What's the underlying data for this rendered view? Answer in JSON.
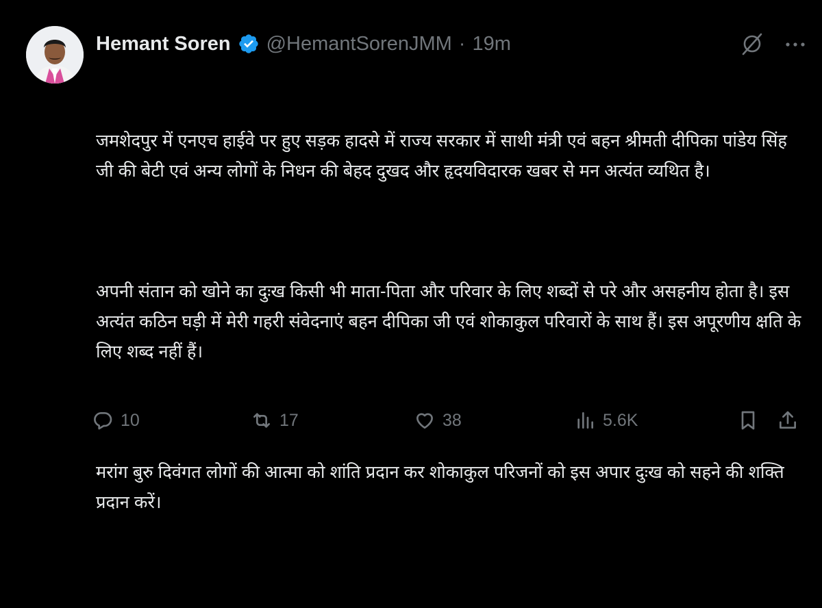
{
  "tweet": {
    "author_name": "Hemant Soren",
    "handle": "@HemantSorenJMM",
    "separator": "·",
    "time": "19m",
    "paragraphs": [
      "जमशेदपुर में एनएच हाईवे पर हुए सड़क हादसे में राज्य सरकार में साथी मंत्री एवं बहन श्रीमती दीपिका पांडेय सिंह जी की बेटी एवं अन्य लोगों के निधन की बेहद दुखद और हृदयविदारक खबर से मन अत्यंत व्यथित है।",
      "अपनी संतान को खोने का दुःख किसी भी माता-पिता और परिवार के लिए शब्दों से परे और असहनीय होता है। इस अत्यंत कठिन घड़ी में मेरी गहरी संवेदनाएं बहन दीपिका जी एवं शोकाकुल परिवारों के साथ हैं। इस अपूरणीय क्षति के लिए शब्द नहीं हैं।",
      "मरांग बुरु दिवंगत लोगों की आत्मा को शांति प्रदान कर शोकाकुल परिजनों को इस अपार दुःख को सहने की शक्ति प्रदान करें।"
    ],
    "stats": {
      "replies": "10",
      "reposts": "17",
      "likes": "38",
      "views": "5.6K"
    }
  },
  "colors": {
    "background": "#000000",
    "text": "#e7e9ea",
    "muted": "#71767b",
    "verified": "#1d9bf0"
  },
  "icons": [
    "avatar",
    "verified-badge-icon",
    "grok-icon",
    "more-icon",
    "reply-icon",
    "repost-icon",
    "like-icon",
    "views-icon",
    "bookmark-icon",
    "share-icon"
  ]
}
